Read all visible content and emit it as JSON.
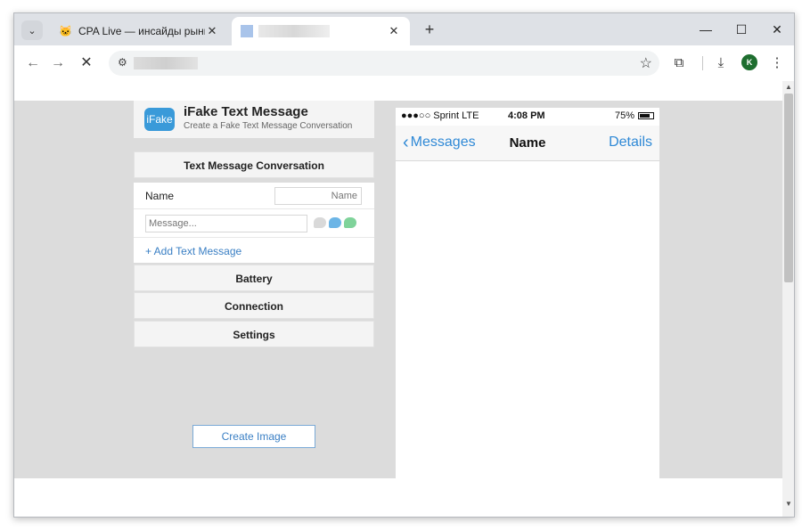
{
  "browser": {
    "tabs": [
      {
        "title": "CPA Live — инсайды рынка",
        "favicon": "cat-icon"
      },
      {
        "title": "",
        "favicon": "page-icon"
      }
    ],
    "window_controls": {
      "minimize": "—",
      "maximize": "☐",
      "close": "✕"
    }
  },
  "app": {
    "logo_text": "iFake",
    "title": "iFake Text Message",
    "subtitle": "Create a Fake Text Message Conversation",
    "section_conversation": "Text Message Conversation",
    "name_label": "Name",
    "name_placeholder": "Name",
    "message_placeholder": "Message...",
    "add_message": "+ Add Text Message",
    "section_battery": "Battery",
    "section_connection": "Connection",
    "section_settings": "Settings",
    "create_button": "Create Image",
    "bubble_colors": [
      "#d9d9d9",
      "#6cb5e6",
      "#7fd39a"
    ]
  },
  "phone": {
    "carrier": "●●●○○ Sprint  LTE",
    "time": "4:08 PM",
    "battery_pct": "75%",
    "battery_level": 0.75,
    "back_label": "Messages",
    "title": "Name",
    "details": "Details"
  }
}
